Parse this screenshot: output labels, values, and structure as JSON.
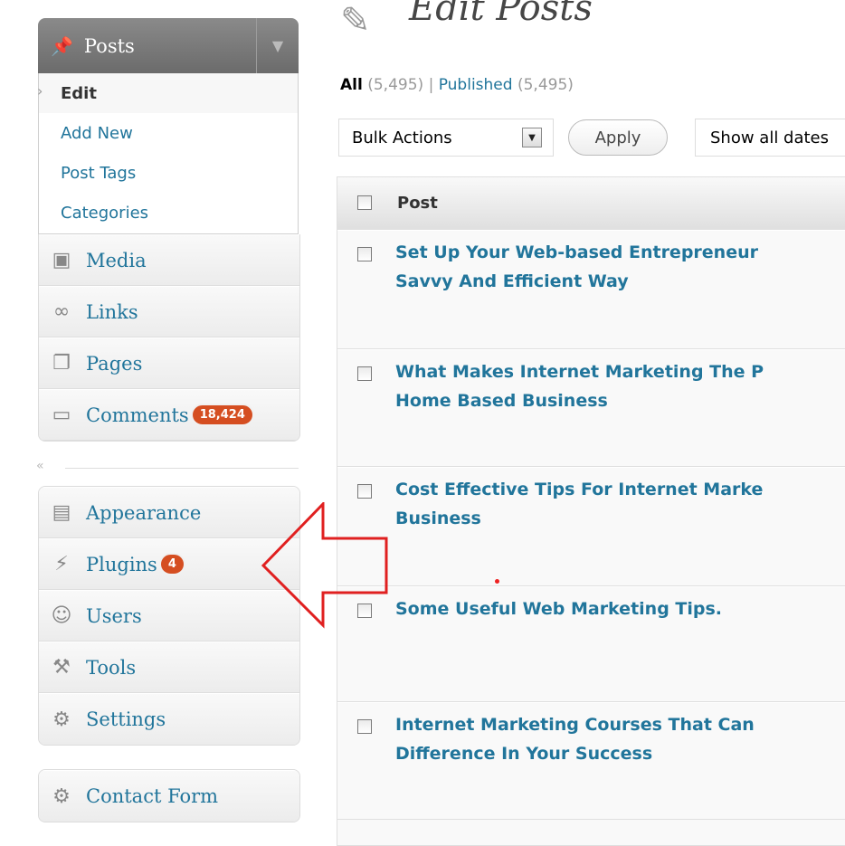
{
  "sidebar": {
    "posts": {
      "label": "Posts",
      "submenu": [
        "Edit",
        "Add New",
        "Post Tags",
        "Categories"
      ]
    },
    "group1": [
      {
        "label": "Media",
        "icon": "media-icon"
      },
      {
        "label": "Links",
        "icon": "links-icon"
      },
      {
        "label": "Pages",
        "icon": "pages-icon"
      },
      {
        "label": "Comments",
        "icon": "comments-icon",
        "badge": "18,424"
      }
    ],
    "group2": [
      {
        "label": "Appearance",
        "icon": "appearance-icon"
      },
      {
        "label": "Plugins",
        "icon": "plugins-icon",
        "badge": "4"
      },
      {
        "label": "Users",
        "icon": "users-icon"
      },
      {
        "label": "Tools",
        "icon": "tools-icon"
      },
      {
        "label": "Settings",
        "icon": "settings-icon"
      }
    ],
    "group3": [
      {
        "label": "Contact Form",
        "icon": "contact-form-icon"
      }
    ],
    "collapse_glyph": "«"
  },
  "main": {
    "title": "Edit Posts",
    "filters": {
      "all_label": "All",
      "all_count": "(5,495)",
      "separator": "|",
      "published_label": "Published",
      "published_count": "(5,495)"
    },
    "bulk_actions": "Bulk Actions",
    "apply": "Apply",
    "dates": "Show all dates",
    "column_header": "Post",
    "posts": [
      [
        "Set Up Your Web-based Entrepreneur",
        "Savvy And Efficient Way"
      ],
      [
        "What Makes Internet Marketing The P",
        "Home Based Business"
      ],
      [
        "Cost Effective Tips For Internet Marke",
        "Business"
      ],
      [
        "Some Useful Web Marketing Tips.",
        ""
      ],
      [
        "Internet Marketing Courses That Can",
        "Difference In Your Success"
      ]
    ]
  },
  "colors": {
    "link": "#21759b",
    "badge": "#d54e21",
    "annotation": "#e02020"
  }
}
